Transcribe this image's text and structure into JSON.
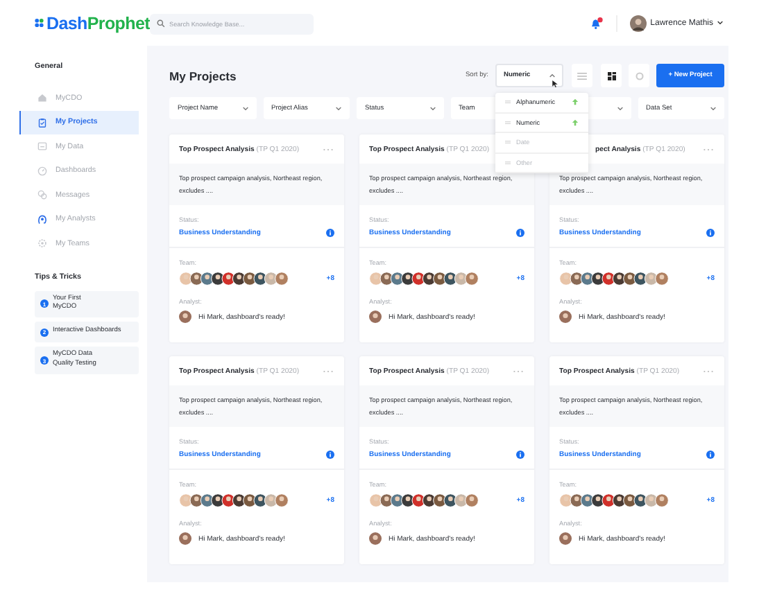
{
  "header": {
    "logo": {
      "first": "Dash",
      "second": "Prophet"
    },
    "search": {
      "placeholder": "Search Knowledge Base..."
    },
    "notifications": {
      "unread": true
    },
    "user": {
      "name": "Lawrence Mathis"
    }
  },
  "sidebar": {
    "title": "General",
    "items": [
      {
        "label": "MyCDO",
        "selected": false
      },
      {
        "label": "My Projects",
        "selected": true
      },
      {
        "label": "My Data",
        "selected": false
      },
      {
        "label": "Dashboards",
        "selected": false
      },
      {
        "label": "Messages",
        "selected": false
      },
      {
        "label": "My Analysts",
        "selected": false
      },
      {
        "label": "My Teams",
        "selected": false
      }
    ],
    "tips_title": "Tips & Tricks",
    "tips": [
      {
        "number": "1",
        "text": "Your First MyCDO"
      },
      {
        "number": "2",
        "text": "Interactive Dashboards"
      },
      {
        "number": "3",
        "text": "MyCDO Data Quality Testing"
      }
    ]
  },
  "main": {
    "title": "My Projects",
    "sort": {
      "label": "Sort by:",
      "value": "Numeric",
      "expanded": true,
      "options": [
        {
          "label": "Alphanumeric",
          "kind": "enabled"
        },
        {
          "label": "Numeric",
          "kind": "enabled"
        },
        {
          "label": "Date",
          "kind": "disabled"
        },
        {
          "label": "Other",
          "kind": "disabled"
        }
      ]
    },
    "views": [
      {
        "kind": "list",
        "selected": false
      },
      {
        "kind": "grid",
        "selected": true
      }
    ],
    "new_button": "+ New Project",
    "filters": [
      {
        "label": "Project Name",
        "caret": true
      },
      {
        "label": "Project Alias",
        "caret": true
      },
      {
        "label": "Status",
        "caret": true
      },
      {
        "label": "Team",
        "caret": false
      },
      {
        "caret": true
      },
      {
        "label": "Data Set",
        "caret": true
      }
    ],
    "cards": [
      {
        "title": "Top Prospect Analysis",
        "code": "(TP Q1 2020)",
        "menu": true,
        "covered": false,
        "description": "Top prospect campaign analysis, Northeast region, excludes ....",
        "status_label": "Status:",
        "status": "Business Understanding",
        "team_label": "Team:",
        "team_more": "+8",
        "analyst_label": "Analyst:",
        "message": "Hi Mark, dashboard's ready!"
      },
      {
        "title": "Top Prospect Analysis",
        "code": "(TP Q1 2020)",
        "menu": false,
        "covered": false,
        "description": "Top prospect campaign analysis, Northeast region, excludes ....",
        "status_label": "Status:",
        "status": "Business Understanding",
        "team_label": "Team:",
        "team_more": "+8",
        "analyst_label": "Analyst:",
        "message": "Hi Mark, dashboard's ready!"
      },
      {
        "title": "pect Analysis",
        "code": "(TP Q1 2020)",
        "menu": true,
        "covered": true,
        "description": "Top prospect campaign analysis, Northeast region, excludes ....",
        "status_label": "Status:",
        "status": "Business Understanding",
        "team_label": "Team:",
        "team_more": "+8",
        "analyst_label": "Analyst:",
        "message": "Hi Mark, dashboard's ready!"
      },
      {
        "title": "Top Prospect Analysis",
        "code": "(TP Q1 2020)",
        "menu": true,
        "covered": false,
        "description": "Top prospect campaign analysis, Northeast region, excludes ....",
        "status_label": "Status:",
        "status": "Business Understanding",
        "team_label": "Team:",
        "team_more": "+8",
        "analyst_label": "Analyst:",
        "message": "Hi Mark, dashboard's ready!"
      },
      {
        "title": "Top Prospect Analysis",
        "code": "(TP Q1 2020)",
        "menu": true,
        "covered": false,
        "description": "Top prospect campaign analysis, Northeast region, excludes ....",
        "status_label": "Status:",
        "status": "Business Understanding",
        "team_label": "Team:",
        "team_more": "+8",
        "analyst_label": "Analyst:",
        "message": "Hi Mark, dashboard's ready!"
      },
      {
        "title": "Top Prospect Analysis",
        "code": "(TP Q1 2020)",
        "menu": true,
        "covered": false,
        "description": "Top prospect campaign analysis, Northeast region, excludes ....",
        "status_label": "Status:",
        "status": "Business Understanding",
        "team_label": "Team:",
        "team_more": "+8",
        "analyst_label": "Analyst:",
        "message": "Hi Mark, dashboard's ready!"
      }
    ]
  }
}
